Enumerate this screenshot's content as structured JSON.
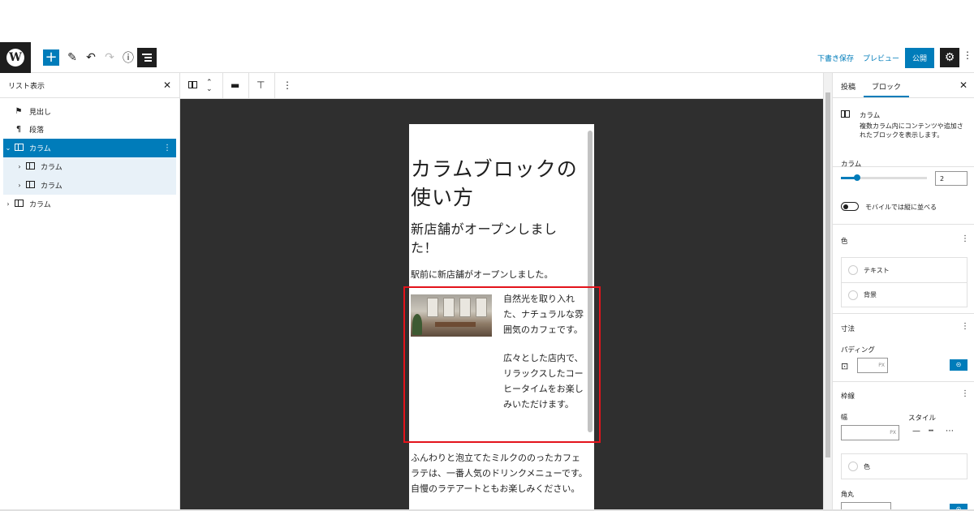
{
  "toolbar": {
    "logo": "W",
    "add_icon": "plus-icon",
    "save_draft": "下書き保存",
    "preview": "プレビュー",
    "publish": "公開"
  },
  "list_view": {
    "title": "リスト表示",
    "items": [
      {
        "label": "見出し",
        "icon": "bookmark-icon"
      },
      {
        "label": "段落",
        "icon": "pilcrow-icon"
      },
      {
        "label": "カラム",
        "icon": "columns-icon",
        "selected": true
      },
      {
        "label": "カラム",
        "icon": "column-icon"
      },
      {
        "label": "カラム",
        "icon": "column-icon"
      },
      {
        "label": "カラム",
        "icon": "columns-icon"
      }
    ]
  },
  "document": {
    "heading": "カラムブロックの使い方",
    "subheading": "新店舗がオープンしました！",
    "paragraph1": "駅前に新店舗がオープンしました。",
    "column_text1": "自然光を取り入れた、ナチュラルな雰囲気のカフェです。",
    "column_text2": "広々とした店内で、リラックスしたコーヒータイムをお楽しみいただけます。",
    "paragraph2": "ふんわりと泡立てたミルクののったカフェラテは、一番人気のドリンクメニューです。自慢のラテアートともお楽しみください。"
  },
  "sidebar": {
    "tab_post": "投稿",
    "tab_block": "ブロック",
    "block_name": "カラム",
    "block_desc": "複数カラム内にコンテンツや追加されたブロックを表示します。",
    "columns_label": "カラム",
    "columns_value": "2",
    "columns_fraction": 0.2,
    "mobile_stack": "モバイルでは縦に並べる",
    "color_section": "色",
    "color_text": "テキスト",
    "color_bg": "背景",
    "dimensions_section": "寸法",
    "padding_label": "パディング",
    "unit_px": "PX",
    "border_section": "枠線",
    "width_label": "幅",
    "style_label": "スタイル",
    "border_color": "色",
    "radius_label": "角丸"
  },
  "colors": {
    "accent": "#007cba",
    "highlight": "#e3131b",
    "canvas": "#2f2f2f"
  }
}
